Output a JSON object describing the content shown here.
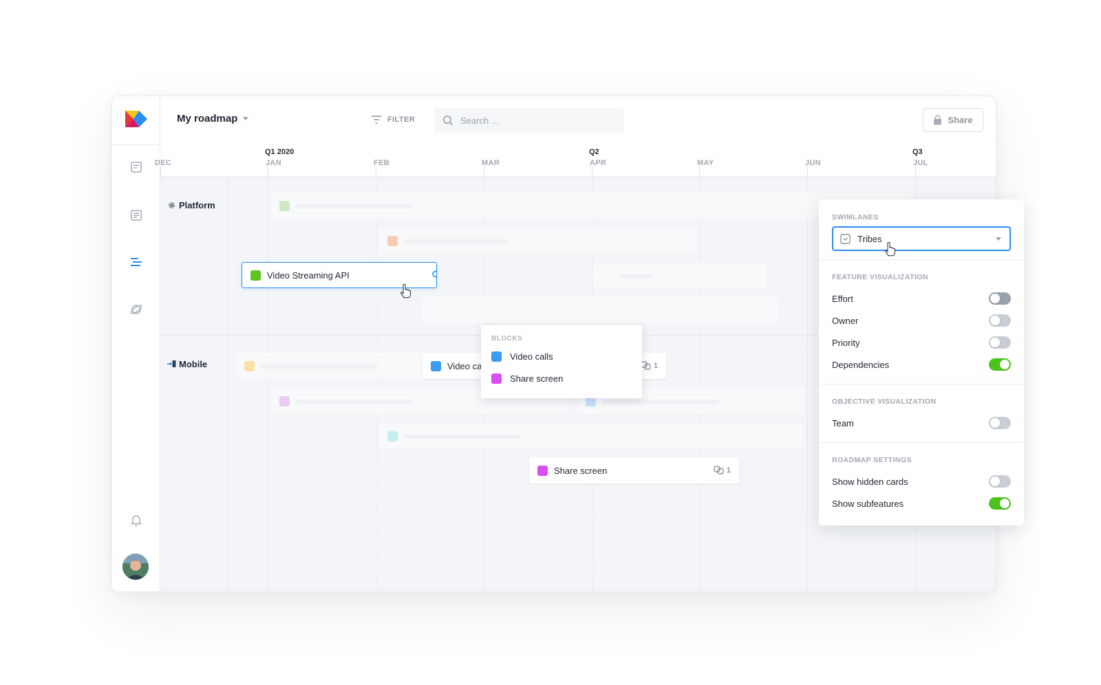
{
  "header": {
    "title": "My roadmap",
    "filter_label": "FILTER",
    "search_placeholder": "Search ...",
    "share_label": "Share"
  },
  "timeline": {
    "quarters": [
      "Q1 2020",
      "Q2",
      "Q3"
    ],
    "months": [
      "DEC",
      "JAN",
      "FEB",
      "MAR",
      "APR",
      "MAY",
      "JUN",
      "JUL"
    ]
  },
  "lanes": [
    {
      "label": "Platform"
    },
    {
      "label": "Mobile"
    }
  ],
  "cards": {
    "video_streaming": {
      "label": "Video Streaming API",
      "color": "#5ec41f"
    },
    "video_calls": {
      "label": "Video calls",
      "color": "#3b9bf5",
      "deps": "1"
    },
    "share_screen": {
      "label": "Share screen",
      "color": "#d94ef2",
      "deps": "1"
    }
  },
  "blocks_popover": {
    "header": "BLOCKS",
    "items": [
      {
        "label": "Video calls",
        "color": "#3b9bf5"
      },
      {
        "label": "Share screen",
        "color": "#d94ef2"
      }
    ]
  },
  "fab_label": "+",
  "settings": {
    "swimlanes_header": "SWIMLANES",
    "swimlanes_value": "Tribes",
    "feature_header": "FEATURE VISUALIZATION",
    "feature_items": [
      {
        "label": "Effort",
        "on": false
      },
      {
        "label": "Owner",
        "on": false
      },
      {
        "label": "Priority",
        "on": false
      },
      {
        "label": "Dependencies",
        "on": true
      }
    ],
    "objective_header": "OBJECTIVE VISUALIZATION",
    "objective_items": [
      {
        "label": "Team",
        "on": false
      }
    ],
    "roadmap_header": "ROADMAP SETTINGS",
    "roadmap_items": [
      {
        "label": "Show hidden cards",
        "on": false
      },
      {
        "label": "Show subfeatures",
        "on": true
      }
    ]
  },
  "colors": {
    "accent": "#2a8cf3",
    "toggle_on": "#4cc31b",
    "toggle_off": "#c9ced6"
  }
}
